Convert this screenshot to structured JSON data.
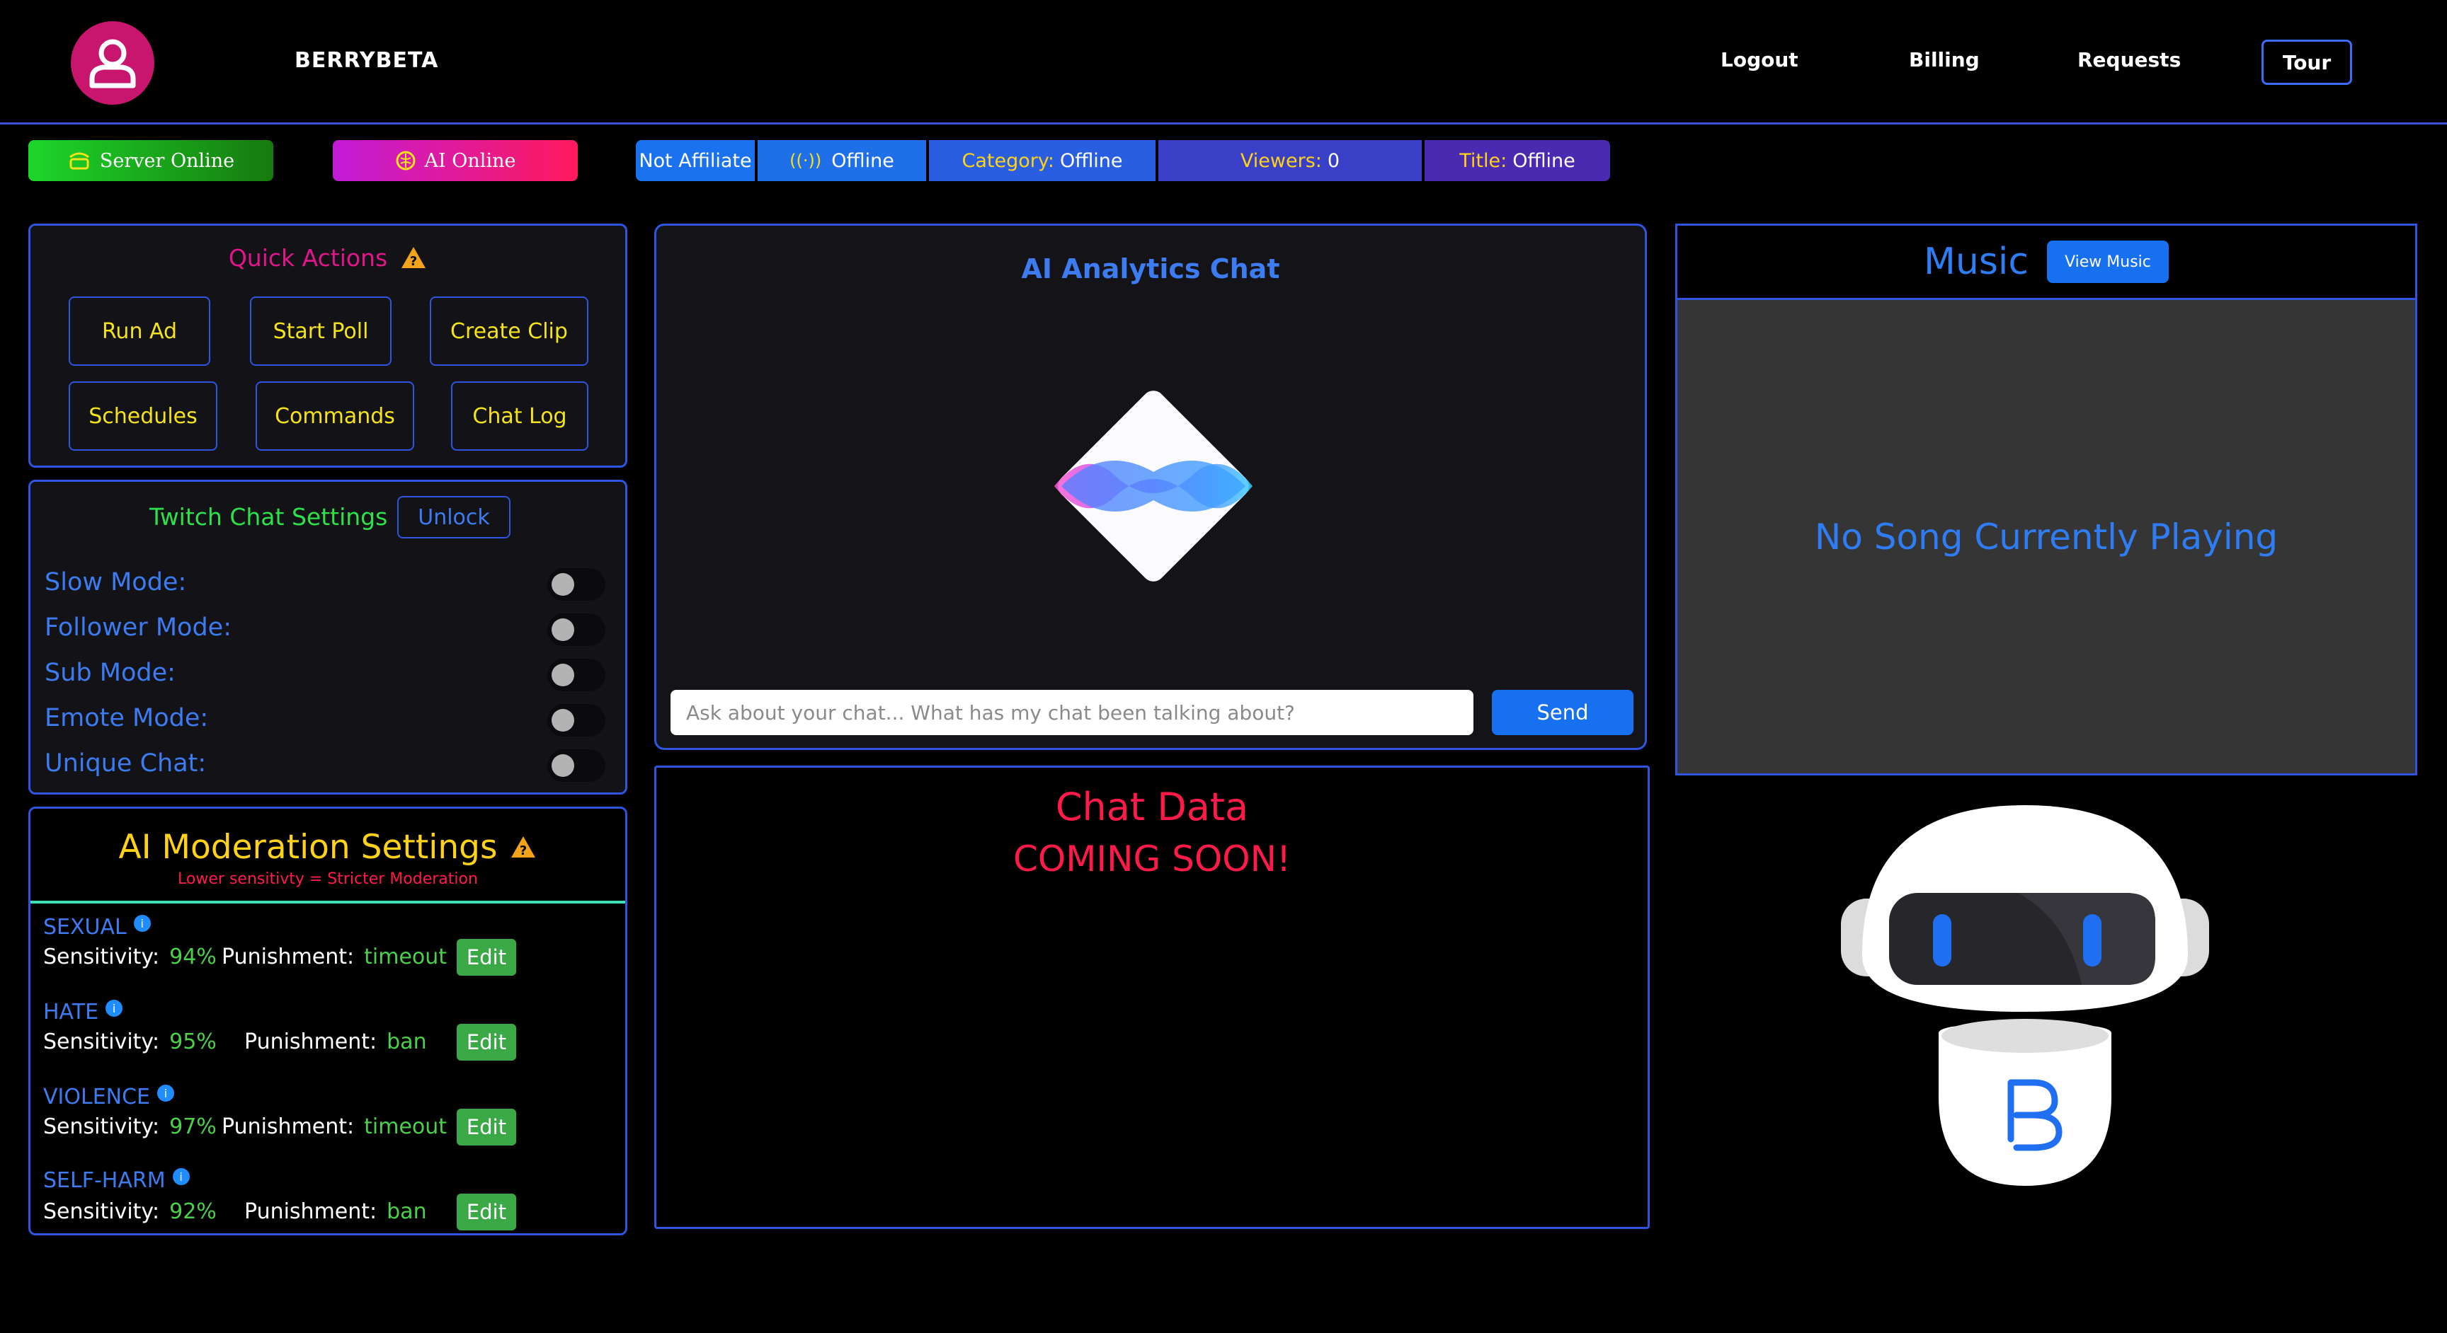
{
  "header": {
    "brand": "BERRYBETA",
    "nav": [
      "Logout",
      "Billing",
      "Requests"
    ],
    "tour": "Tour"
  },
  "status": {
    "server": "Server Online",
    "ai": "AI Online",
    "affiliate": "Not Affiliate",
    "stream": "Offline",
    "category_label": "Category:",
    "category_value": "Offline",
    "viewers_label": "Viewers:",
    "viewers_value": "0",
    "title_label": "Title:",
    "title_value": "Offline"
  },
  "quick_actions": {
    "title": "Quick Actions",
    "buttons": [
      "Run Ad",
      "Start Poll",
      "Create Clip",
      "Schedules",
      "Commands",
      "Chat Log"
    ]
  },
  "twitch_settings": {
    "title": "Twitch Chat Settings",
    "unlock": "Unlock",
    "items": [
      "Slow Mode:",
      "Follower Mode:",
      "Sub Mode:",
      "Emote Mode:",
      "Unique Chat:"
    ]
  },
  "moderation": {
    "title": "AI Moderation Settings",
    "subtitle": "Lower sensitivty = Stricter Moderation",
    "sensitivity_label": "Sensitivity:",
    "punishment_label": "Punishment:",
    "edit": "Edit",
    "rows": [
      {
        "category": "SEXUAL",
        "sensitivity": "94%",
        "punishment": "timeout"
      },
      {
        "category": "HATE",
        "sensitivity": "95%",
        "punishment": "ban"
      },
      {
        "category": "VIOLENCE",
        "sensitivity": "97%",
        "punishment": "timeout"
      },
      {
        "category": "SELF-HARM",
        "sensitivity": "92%",
        "punishment": "ban"
      }
    ]
  },
  "analytics": {
    "title": "AI Analytics Chat",
    "placeholder": "Ask about your chat... What has my chat been talking about?",
    "send": "Send"
  },
  "chat_data": {
    "line1": "Chat Data",
    "line2": "COMING SOON!"
  },
  "music": {
    "title": "Music",
    "view": "View Music",
    "empty": "No Song Currently Playing"
  },
  "colors": {
    "accent_blue": "#2f55e0",
    "brand_pink": "#c8166f",
    "warn_yellow": "#f5e31a",
    "danger_red": "#ff1a4a",
    "success_green": "#4bd04b"
  }
}
